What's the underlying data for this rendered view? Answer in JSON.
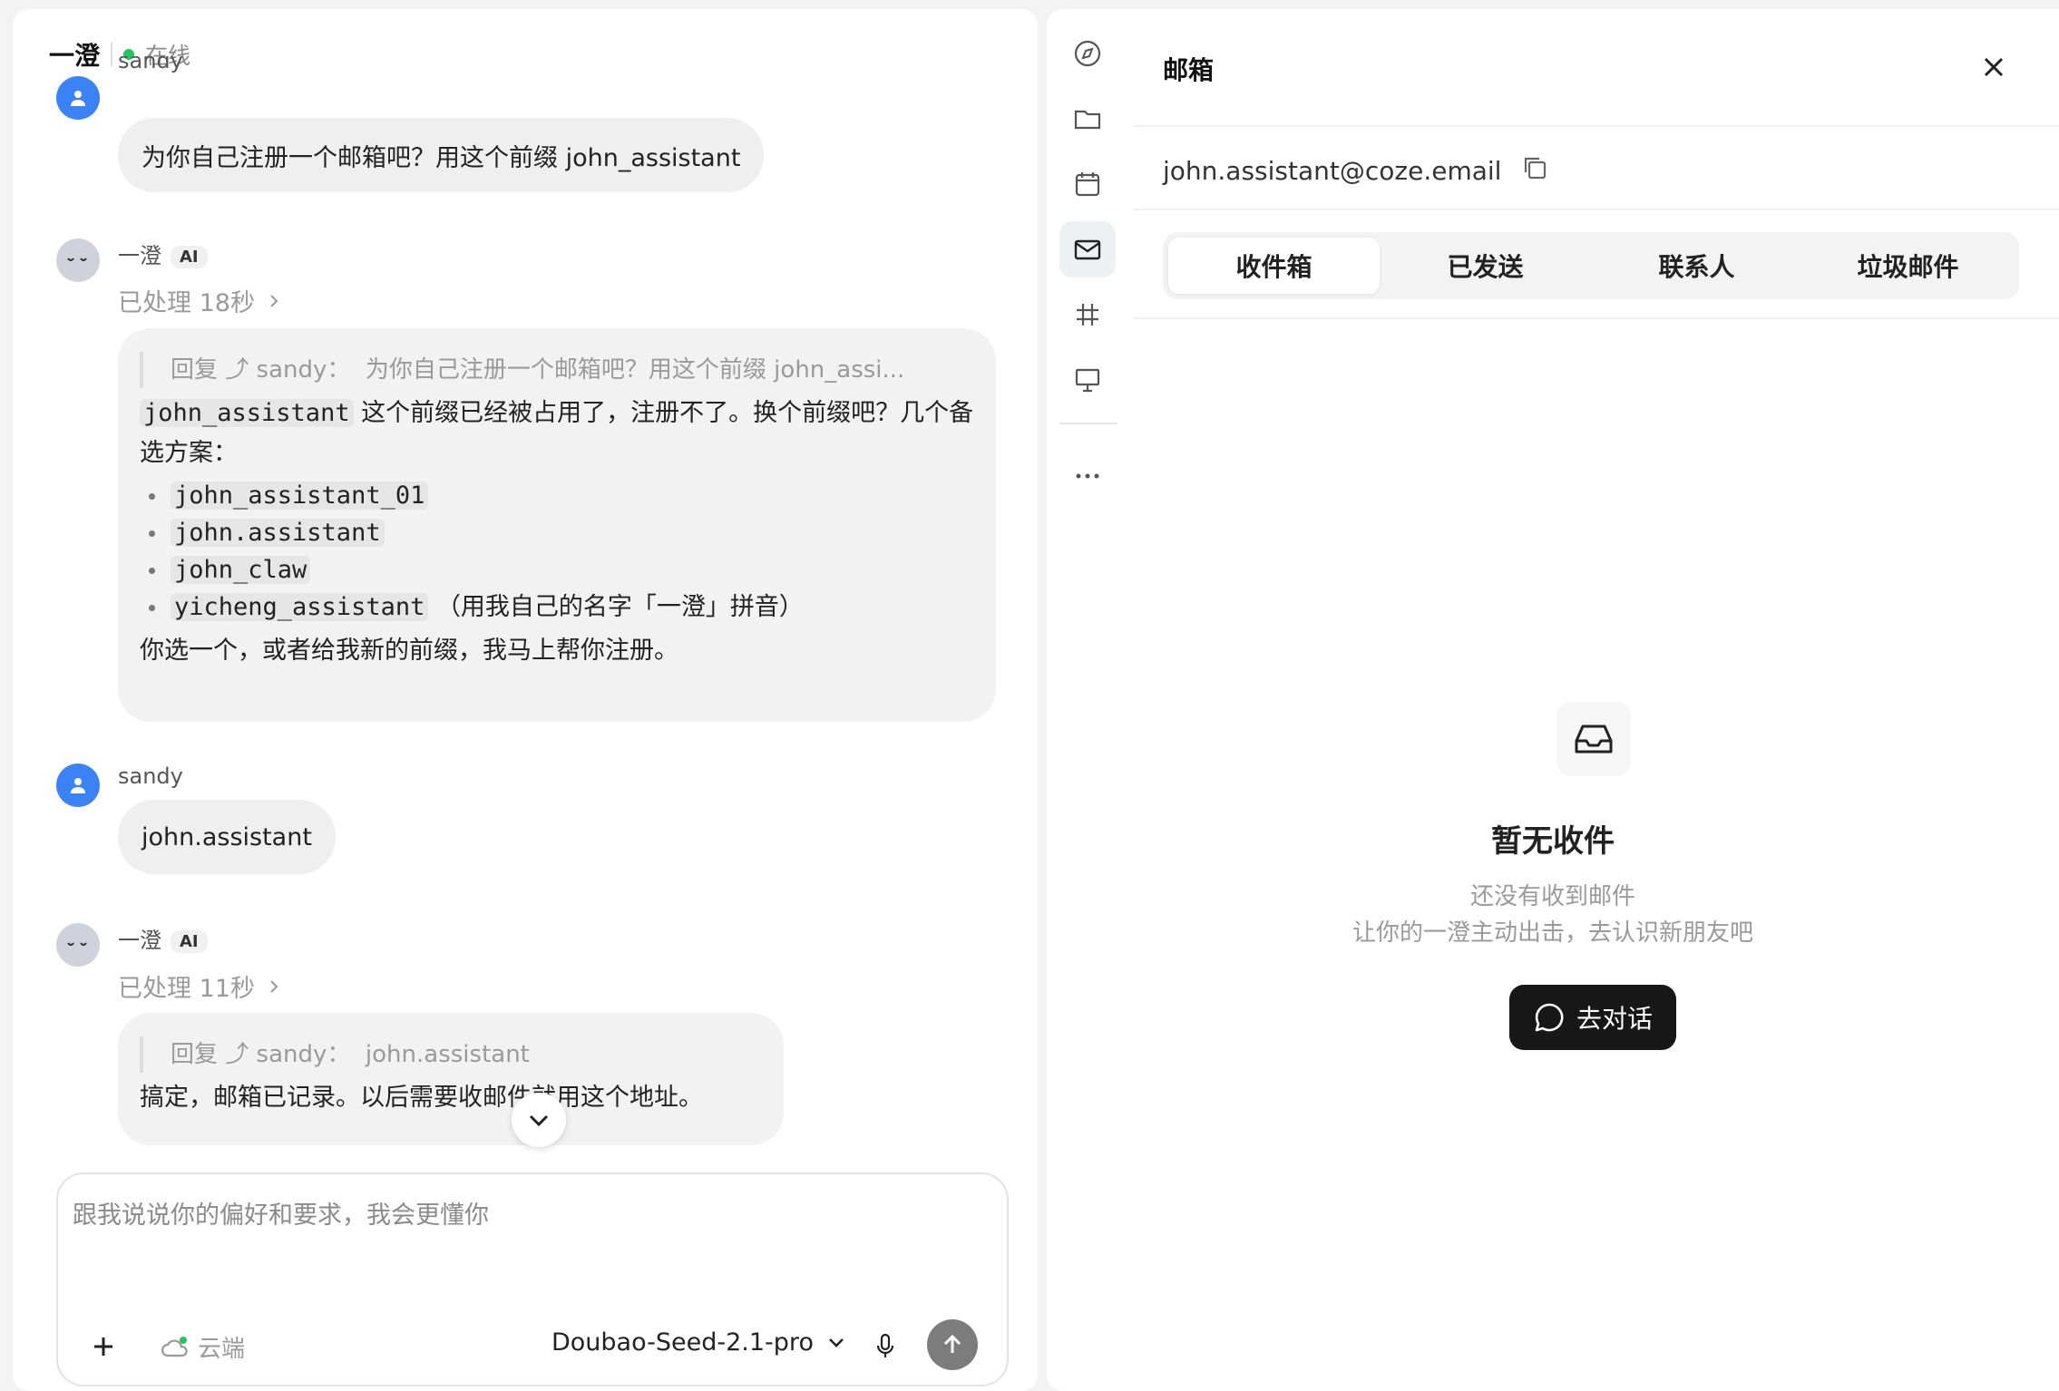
{
  "chat": {
    "title": "一澄",
    "status": "在线",
    "messages": {
      "user1": {
        "sender": "sandy",
        "text": "为你自己注册一个邮箱吧？用这个前缀 john_assistant"
      },
      "ai1": {
        "sender": "一澄",
        "badge": "AI",
        "processed": "已处理 18秒",
        "quote_prefix": "回复 ⤴ sandy：",
        "quote_text": "为你自己注册一个邮箱吧？用这个前缀 john_assi...",
        "intro_code": "john_assistant",
        "intro_text": "这个前缀已经被占用了，注册不了。换个前缀吧？几个备选方案：",
        "options": [
          "john_assistant_01",
          "john.assistant",
          "john_claw",
          "yicheng_assistant"
        ],
        "option4_note": "（用我自己的名字「一澄」拼音）",
        "closing": "你选一个，或者给我新的前缀，我马上帮你注册。"
      },
      "user2": {
        "sender": "sandy",
        "text": "john.assistant"
      },
      "ai2": {
        "sender": "一澄",
        "badge": "AI",
        "processed": "已处理 11秒",
        "quote_prefix": "回复 ⤴ sandy：",
        "quote_text": "john.assistant",
        "body": "搞定，邮箱已记录。以后需要收邮件就用这个地址。"
      }
    },
    "composer": {
      "placeholder": "跟我说说你的偏好和要求，我会更懂你",
      "cloud_label": "云端",
      "model": "Doubao-Seed-2.1-pro"
    }
  },
  "mail": {
    "title": "邮箱",
    "address": "john.assistant@coze.email",
    "tabs": [
      "收件箱",
      "已发送",
      "联系人",
      "垃圾邮件"
    ],
    "active_tab": "收件箱",
    "empty": {
      "title": "暂无收件",
      "line1": "还没有收到邮件",
      "line2": "让你的一澄主动出击，去认识新朋友吧",
      "button": "去对话"
    }
  },
  "nav_icons": [
    "compass-icon",
    "folder-icon",
    "calendar-icon",
    "mail-icon",
    "hash-icon",
    "presentation-icon",
    "more-icon"
  ],
  "colors": {
    "online": "#22c55e",
    "user_avatar": "#3b82f6",
    "dark_button": "#171717"
  }
}
